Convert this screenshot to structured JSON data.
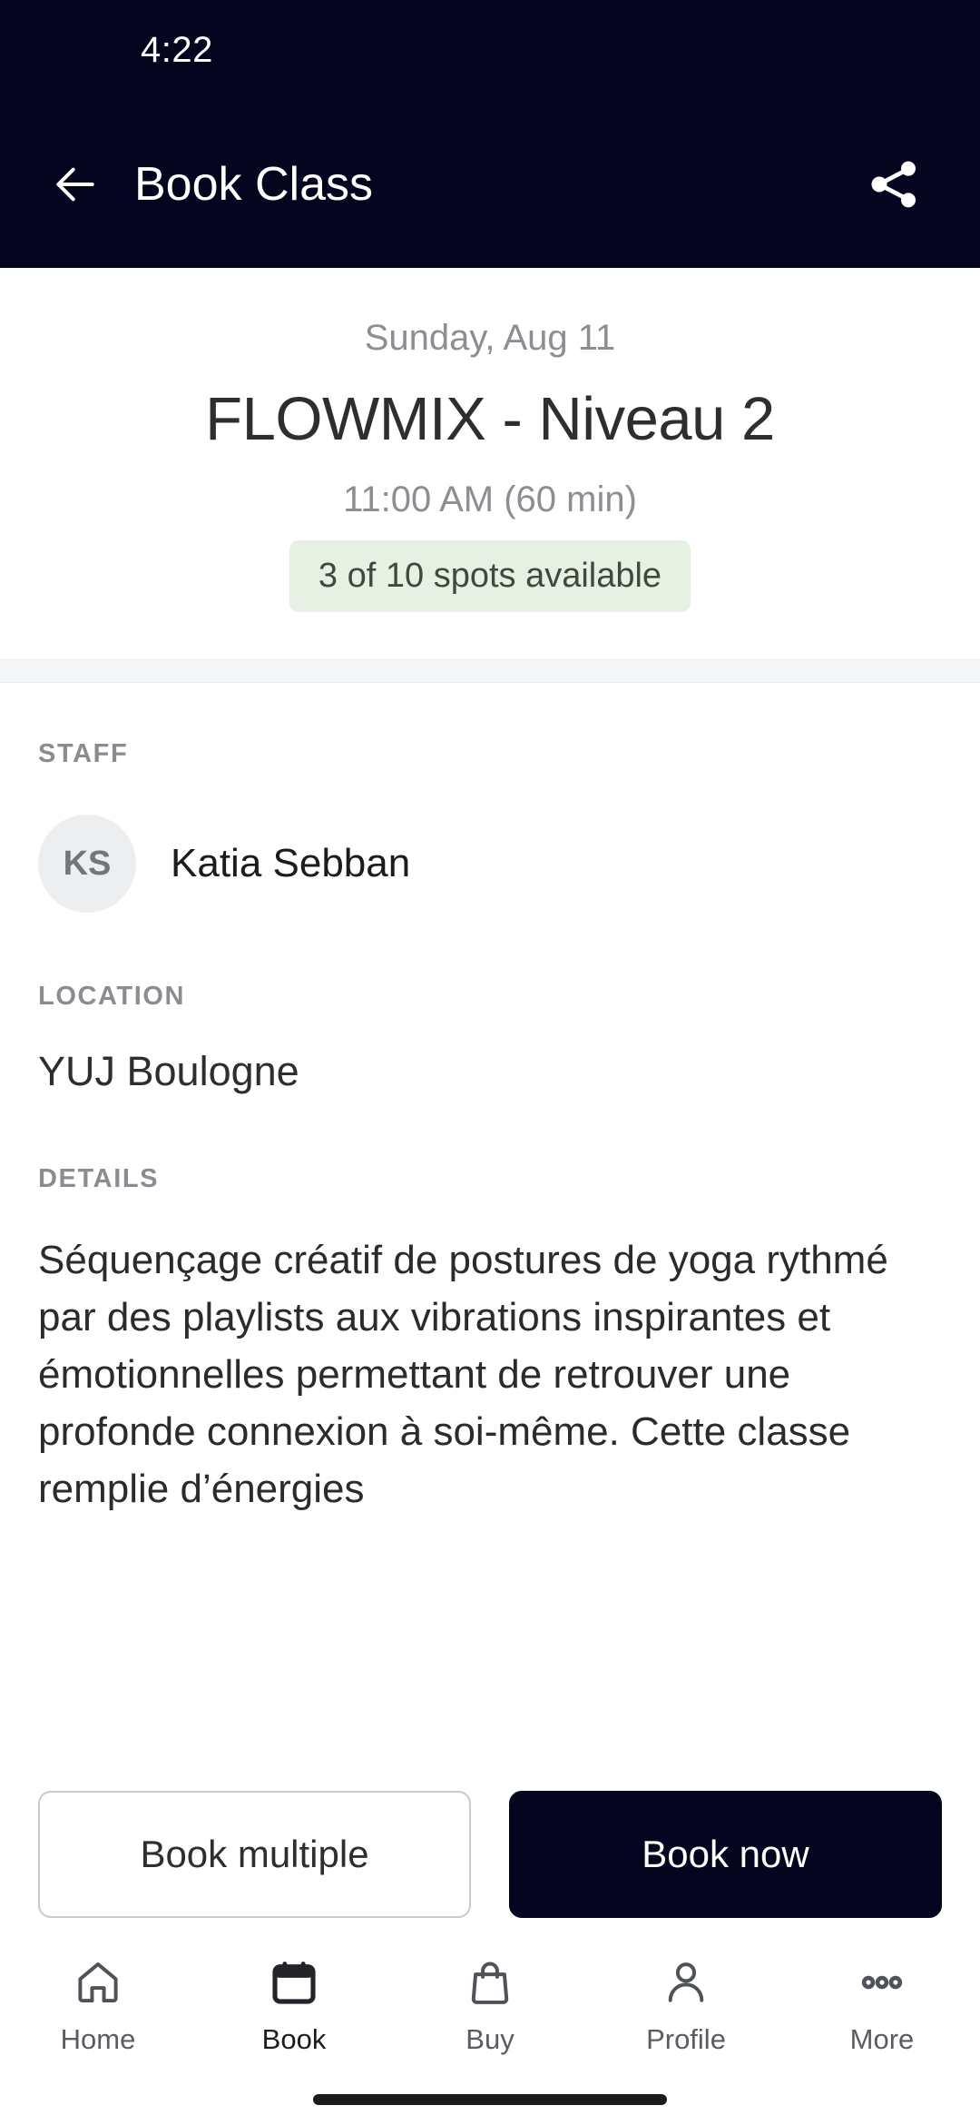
{
  "status_bar": {
    "time": "4:22"
  },
  "app_bar": {
    "title": "Book Class",
    "back_icon": "arrow-left-icon",
    "share_icon": "share-icon"
  },
  "hero": {
    "date": "Sunday, Aug 11",
    "class_title": "FLOWMIX - Niveau 2",
    "time": "11:00 AM (60 min)",
    "spots_badge": "3 of 10 spots available",
    "spots_available": 3,
    "spots_total": 10,
    "badge_bg": "#e6f0e3",
    "badge_text_color": "#3d4a3c"
  },
  "sections": {
    "staff": {
      "label": "STAFF",
      "avatar_initials": "KS",
      "name": "Katia Sebban"
    },
    "location": {
      "label": "LOCATION",
      "value": "YUJ Boulogne"
    },
    "details": {
      "label": "DETAILS",
      "text": "Séquençage créatif de postures de yoga rythmé par des playlists aux vibrations inspirantes et émotionnelles permettant de retrouver une profonde connexion à soi-même. Cette classe remplie d’énergies"
    }
  },
  "actions": {
    "secondary_label": "Book multiple",
    "primary_label": "Book now",
    "primary_bg": "#05051f"
  },
  "bottom_nav": {
    "items": [
      {
        "label": "Home",
        "icon": "home-icon",
        "active": false
      },
      {
        "label": "Book",
        "icon": "calendar-icon",
        "active": true
      },
      {
        "label": "Buy",
        "icon": "shopping-bag-icon",
        "active": false
      },
      {
        "label": "Profile",
        "icon": "person-icon",
        "active": false
      },
      {
        "label": "More",
        "icon": "more-dots-icon",
        "active": false
      }
    ]
  },
  "theme": {
    "app_bar_bg": "#05051f",
    "page_bg": "#ffffff",
    "muted_text": "#8d8d93"
  }
}
